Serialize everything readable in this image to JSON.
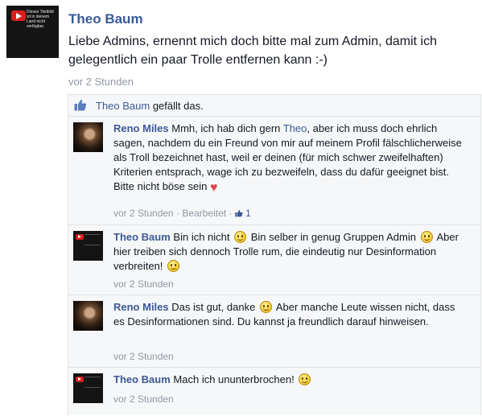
{
  "post": {
    "author": "Theo Baum",
    "avatar_text": "Dieses Titelbild ist in deinem Land nicht verfügbar.",
    "text": "Liebe Admins, ernennt mich doch bitte mal zum Admin, damit ich gelegentlich ein paar Trolle entfernen kann :-)",
    "time": "vor 2 Stunden"
  },
  "likes": {
    "name": "Theo Baum",
    "suffix": " gefällt das."
  },
  "comments": [
    {
      "author": "Reno Miles",
      "text_1": "Mmh, ich hab dich gern ",
      "mention": "Theo",
      "text_2": ", aber ich muss doch ehrlich sagen, nachdem du ein Freund von mir auf meinem Profil fälschlicherweise als Troll bezeichnet hast, weil er deinen (für mich schwer zweifelhaften) Kriterien entsprach, wage ich zu bezweifeln, dass du dafür geeignet bist.",
      "text_3": "Bitte nicht böse sein ",
      "time": "vor 2 Stunden",
      "sep": " · ",
      "edited": "Bearbeitet",
      "like_count": "1"
    },
    {
      "author": "Theo Baum",
      "text_1": "Bin ich nicht ",
      "text_2": " Bin selber in genug Gruppen Admin ",
      "text_3": " Aber hier treiben sich dennoch Trolle rum, die eindeutig nur Desinformation verbreiten! ",
      "time": "vor 2 Stunden"
    },
    {
      "author": "Reno Miles",
      "text_1": "Das ist gut, danke ",
      "text_2": " Aber manche Leute wissen nicht, dass es Desinformationen sind. Du kannst ja freundlich darauf hinweisen.",
      "time": "vor 2 Stunden"
    },
    {
      "author": "Theo Baum",
      "text_1": "Mach ich ununterbrochen! ",
      "time": "vor 2 Stunden"
    }
  ],
  "colors": {
    "link": "#3b5998",
    "meta": "#9197a3",
    "comment_bg": "#f6f7f9"
  },
  "icons": [
    "thumbs-up-icon",
    "smiley-icon",
    "heart-icon"
  ]
}
